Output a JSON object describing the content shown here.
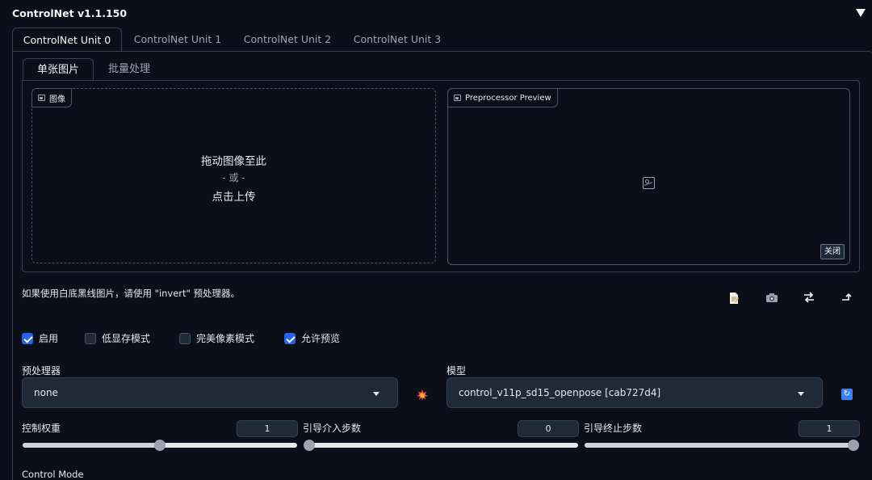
{
  "header": {
    "title": "ControlNet v1.1.150"
  },
  "unit_tabs": [
    {
      "label": "ControlNet Unit 0",
      "active": true
    },
    {
      "label": "ControlNet Unit 1",
      "active": false
    },
    {
      "label": "ControlNet Unit 2",
      "active": false
    },
    {
      "label": "ControlNet Unit 3",
      "active": false
    }
  ],
  "image_tabs": [
    {
      "label": "单张图片",
      "active": true
    },
    {
      "label": "批量处理",
      "active": false
    }
  ],
  "upload": {
    "label": "图像",
    "drag_text": "拖动图像至此",
    "or_text": "- 或 -",
    "click_text": "点击上传"
  },
  "preview": {
    "label": "Preprocessor Preview",
    "close_label": "关闭"
  },
  "hint": "如果使用白底黑线图片，请使用 \"invert\" 预处理器。",
  "toolbar_icons": [
    "new-canvas-icon",
    "camera-icon",
    "swap-icon",
    "send-dimensions-icon"
  ],
  "checkboxes": [
    {
      "label": "启用",
      "checked": true
    },
    {
      "label": "低显存模式",
      "checked": false
    },
    {
      "label": "完美像素模式",
      "checked": false
    },
    {
      "label": "允许预览",
      "checked": true
    }
  ],
  "preprocessor": {
    "label": "预处理器",
    "value": "none"
  },
  "model": {
    "label": "模型",
    "value": "control_v11p_sd15_openpose [cab727d4]"
  },
  "sliders": [
    {
      "label": "控制权重",
      "value": "1",
      "min": 0,
      "max": 2
    },
    {
      "label": "引导介入步数",
      "value": "0",
      "min": 0,
      "max": 1
    },
    {
      "label": "引导终止步数",
      "value": "1",
      "min": 0,
      "max": 1
    }
  ],
  "control_mode": {
    "label": "Control Mode"
  },
  "colors": {
    "background": "#0b0f19",
    "accent": "#2563eb",
    "border": "#374151"
  }
}
